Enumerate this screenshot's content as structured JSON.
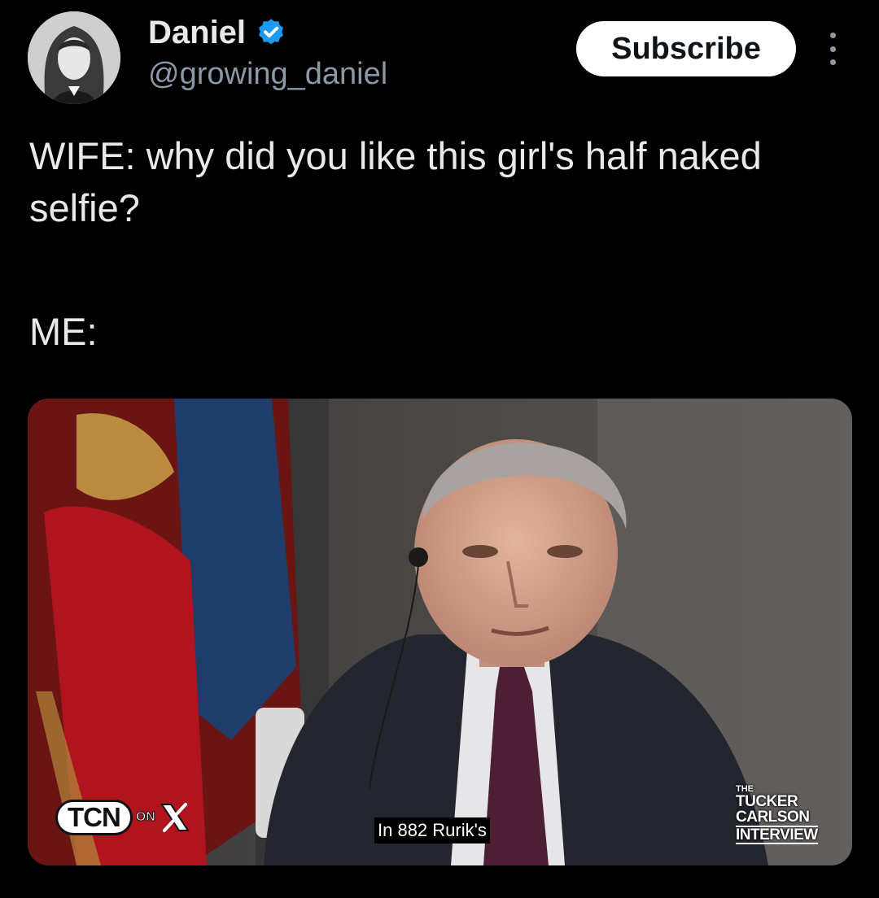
{
  "author": {
    "display_name": "Daniel",
    "handle": "@growing_daniel",
    "verified": true,
    "avatar_icon": "profile-avatar"
  },
  "actions": {
    "subscribe_label": "Subscribe",
    "more_icon": "more-vertical-icon"
  },
  "tweet": {
    "line1": "WIFE: why did you like this girl's half naked selfie?",
    "line2": "ME:"
  },
  "media": {
    "tcn_label": "TCN",
    "tcn_on_label": "ON",
    "subtitle": "In 882 Rurik's",
    "interview_logo": {
      "line1": "THE",
      "line2": "TUCKER",
      "line3": "CARLSON",
      "line4": "INTERVIEW"
    }
  },
  "colors": {
    "background": "#000000",
    "text_primary": "#e7e9ea",
    "text_secondary": "#8b98a5",
    "verified_blue": "#1d9bf0",
    "subscribe_bg": "#ffffff"
  }
}
